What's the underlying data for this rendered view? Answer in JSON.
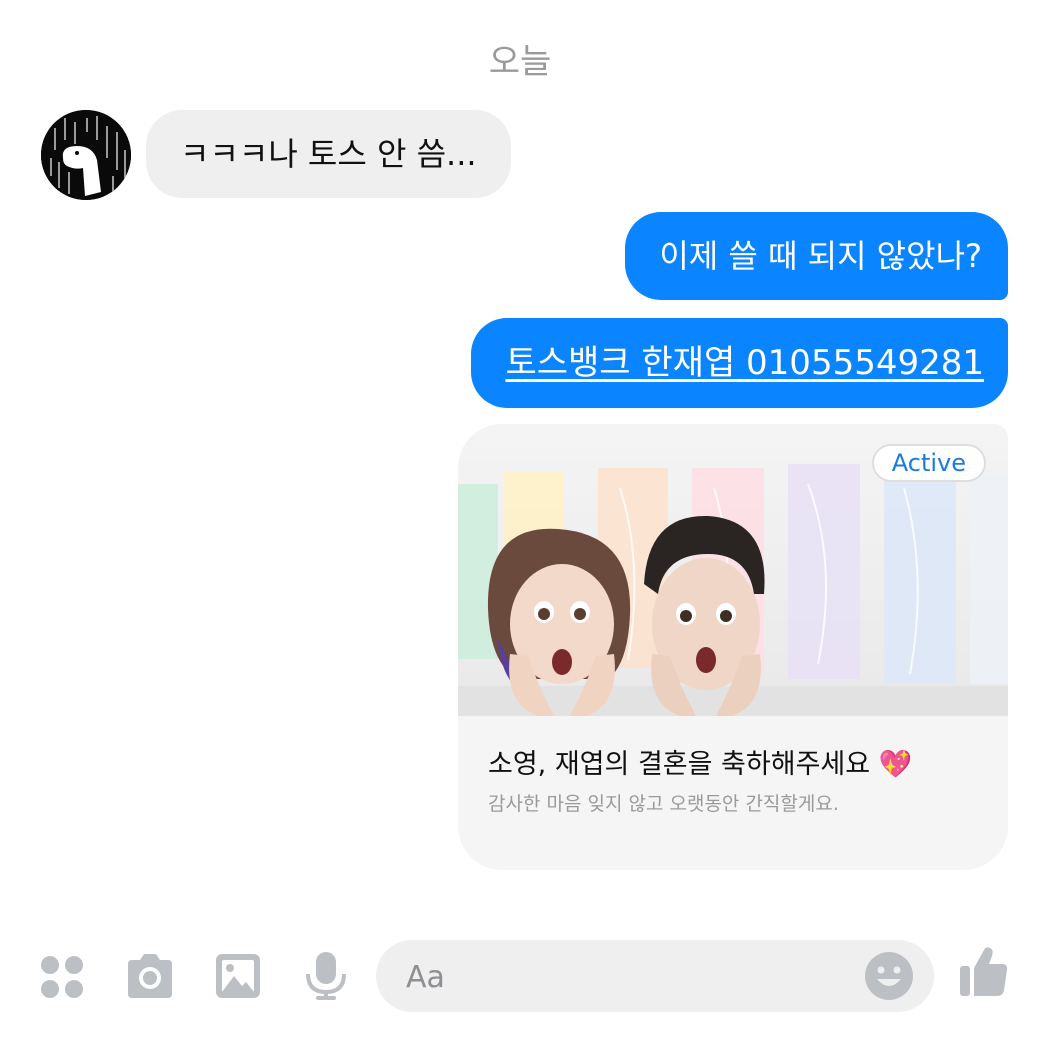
{
  "thread": {
    "date_label": "오늘",
    "messages": [
      {
        "direction": "incoming",
        "text": "ㅋㅋㅋ나 토스 안 씀..."
      },
      {
        "direction": "outgoing",
        "text": "이제 쓸 때 되지 않았나?"
      },
      {
        "direction": "outgoing",
        "text": "토스뱅크 한재엽 01055549281",
        "link": true
      }
    ],
    "card": {
      "badge": "Active",
      "title": "소영, 재엽의 결혼을 축하해주세요 💖",
      "subtitle": "감사한 마음 잊지 않고 오랫동안 간직할게요."
    }
  },
  "composer": {
    "placeholder": "Aa",
    "icons": [
      "apps-icon",
      "camera-icon",
      "image-icon",
      "mic-icon",
      "emoji-icon",
      "thumbs-up-icon"
    ]
  },
  "colors": {
    "accent": "#0a84ff",
    "incoming_bubble": "#efefef",
    "icon_gray": "#bcc0c4"
  }
}
